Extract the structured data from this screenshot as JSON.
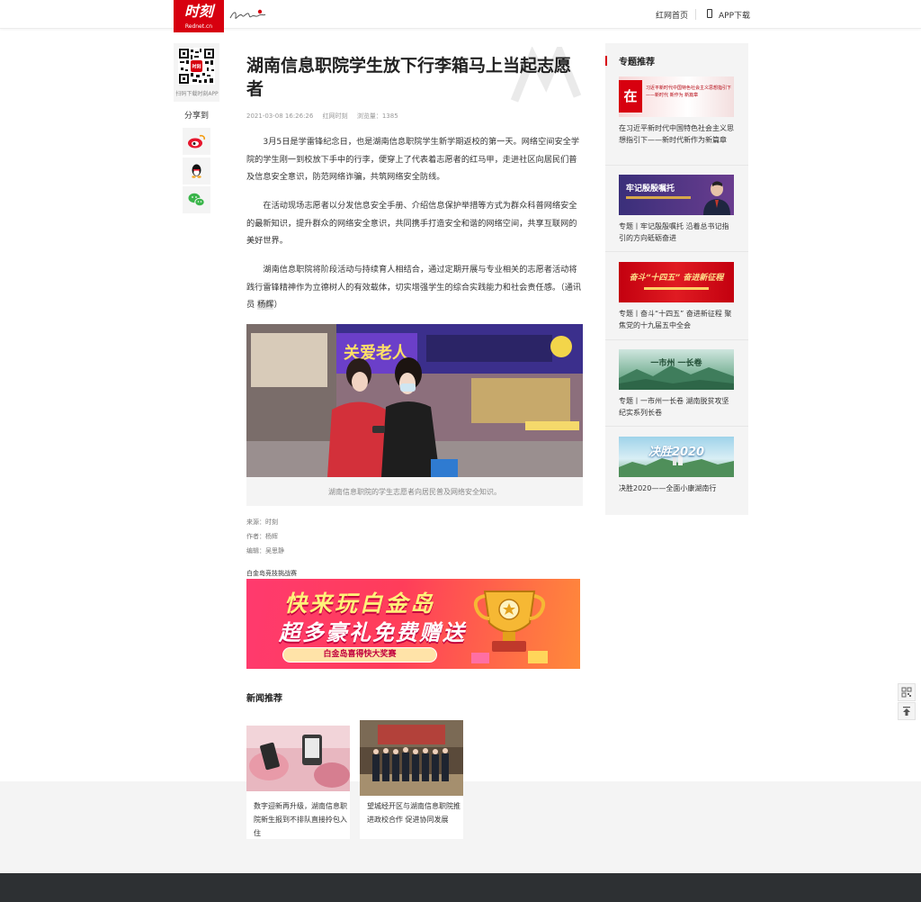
{
  "header": {
    "logo_text": "时刻",
    "logo_sub": "Rednet.cn",
    "nav": [
      {
        "label": "红网首页"
      },
      {
        "label": "APP下载",
        "icon": "phone-icon"
      }
    ]
  },
  "share": {
    "qr_label": "扫码下载时刻APP",
    "label": "分享到",
    "items": [
      {
        "name": "weibo",
        "icon": "weibo-icon",
        "color": "#e6162d"
      },
      {
        "name": "qq",
        "icon": "qq-icon",
        "color": "#000000"
      },
      {
        "name": "wechat",
        "icon": "wechat-icon",
        "color": "#3ab54a"
      }
    ]
  },
  "article": {
    "title": "湖南信息职院学生放下行李箱马上当起志愿者",
    "date": "2021-03-08 16:26:26",
    "source_site": "红网时刻",
    "views": "浏览量：1385",
    "paragraphs": [
      "3月5日是学雷锋纪念日，也是湖南信息职院学生新学期返校的第一天。网络空间安全学院的学生刚一到校放下手中的行李，便穿上了代表着志愿者的红马甲，走进社区向居民们普及信息安全意识，防范网络诈骗，共筑网络安全防线。",
      "在活动现场志愿者以分发信息安全手册、介绍信息保护举措等方式为群众科普网络安全的最新知识，提升群众的网络安全意识，共同携手打造安全和谐的网络空间，共享互联网的美好世界。",
      "湖南信息职院将阶段活动与持续育人相结合，通过定期开展与专业相关的志愿者活动将践行雷锋精神作为立德树人的有效载体，切实增强学生的综合实践能力和社会责任感。（通讯员 "
    ],
    "reporter_name": "杨辉",
    "reporter_close": "）",
    "photo_caption": "湖南信息职院的学生志愿者向居民普及网络安全知识。",
    "source_line": "来源：时刻",
    "author_line": "作者：杨辉",
    "editor_line": "编辑：吴思静"
  },
  "ad": {
    "label": "白金岛竞技挑战赛",
    "line1": "快来玩白金岛",
    "line2": "超多豪礼免费赠送",
    "pill": "白金岛喜得快大奖赛"
  },
  "news_rec": {
    "title": "新闻推荐",
    "items": [
      {
        "text": "数字迎新再升级，湖南信息职院新生报到不排队直接拎包入住"
      },
      {
        "text": "望城经开区与湖南信息职院推进政校合作 促进协同发展"
      }
    ]
  },
  "sidebar": {
    "title": "专题推荐",
    "accent": "#d7000f",
    "items": [
      {
        "text": "在习近平新时代中国特色社会主义思想指引下——新时代新作为新篇章",
        "banner": "习近平新时代中国特色社会主义思想指引下——新时代 新作为 新篇章",
        "banner_mark": "在"
      },
      {
        "text": "专题丨牢记殷殷嘱托 沿着总书记指引的方向砥砺奋进",
        "banner": "牢记殷殷嘱托"
      },
      {
        "text": "专题丨奋斗“十四五” 奋进新征程 聚焦党的十九届五中全会",
        "banner": "奋斗“十四五” 奋进新征程"
      },
      {
        "text": "专题丨一市州一长卷 湖南脱贫攻坚纪实系列长卷",
        "banner": "一市州 一长卷"
      },
      {
        "text": "决胜2020——全面小康湖南行",
        "banner": "决胜2020"
      }
    ]
  }
}
